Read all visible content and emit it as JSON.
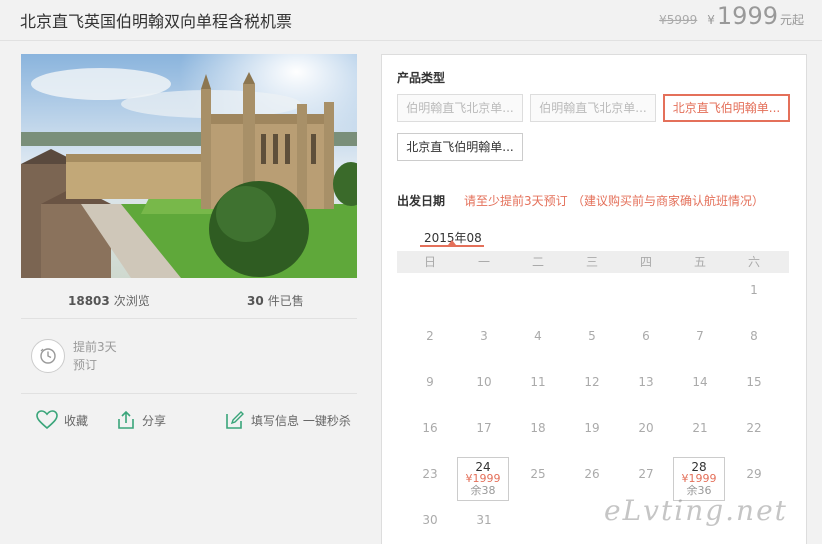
{
  "product": {
    "title": "北京直飞英国伯明翰双向单程含税机票",
    "old_price": "¥5999",
    "currency": "¥",
    "price": "1999",
    "price_unit": "元起"
  },
  "stats": {
    "views_count": "18803",
    "views_label": "次浏览",
    "sold_count": "30",
    "sold_label": "件已售"
  },
  "advance": {
    "line1": "提前3天",
    "line2": "预订"
  },
  "actions": {
    "favorite": "收藏",
    "share": "分享",
    "fill_info": "填写信息 一键秒杀"
  },
  "panel": {
    "product_type_label": "产品类型",
    "options": [
      {
        "label": "伯明翰直飞北京单...",
        "state": "disabled"
      },
      {
        "label": "伯明翰直飞北京单...",
        "state": "disabled"
      },
      {
        "label": "北京直飞伯明翰单...",
        "state": "selected"
      },
      {
        "label": "北京直飞伯明翰单...",
        "state": "normal"
      }
    ],
    "date_label": "出发日期",
    "note1": "请至少提前3天预订",
    "note2": "（建议购买前与商家确认航班情况）",
    "month": "2015年08",
    "weekdays": [
      "日",
      "一",
      "二",
      "三",
      "四",
      "五",
      "六"
    ],
    "days": [
      "1",
      "2",
      "3",
      "4",
      "5",
      "6",
      "7",
      "8",
      "9",
      "10",
      "11",
      "12",
      "13",
      "14",
      "15",
      "16",
      "17",
      "18",
      "19",
      "20",
      "21",
      "22",
      "23",
      "24",
      "25",
      "26",
      "27",
      "28",
      "29",
      "30",
      "31"
    ],
    "available": {
      "24": {
        "price": "¥1999",
        "remain": "余38"
      },
      "28": {
        "price": "¥1999",
        "remain": "余36"
      }
    }
  },
  "watermark": "eLvting.net",
  "colors": {
    "accent": "#e4705a",
    "icon_green": "#3aa57a"
  }
}
